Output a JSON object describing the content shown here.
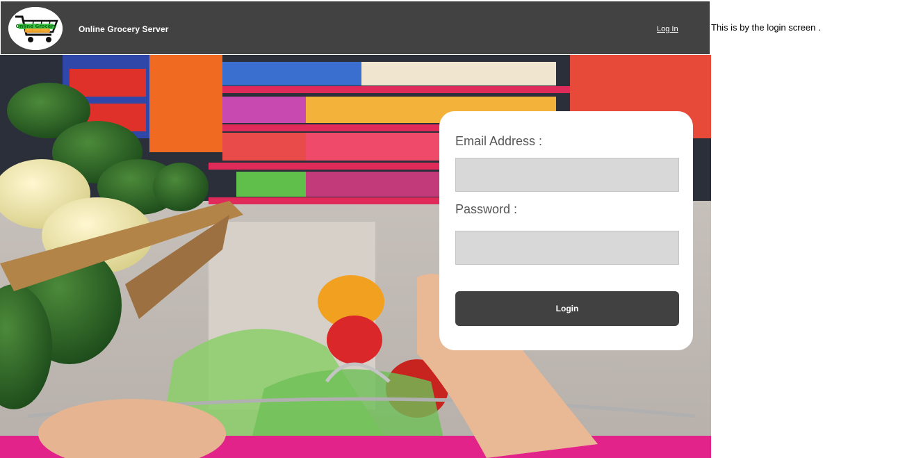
{
  "header": {
    "logo_icon": "shopping-cart-logo",
    "logo_text": "Online Grocery",
    "app_title": "Online Grocery Server",
    "login_link": "Log In"
  },
  "side_note": "This is by the login screen .",
  "hero": {
    "image": "supermarket-cart-photo"
  },
  "login_form": {
    "email_label": "Email Address :",
    "email_value": "",
    "password_label": "Password :",
    "password_value": "",
    "submit_label": "Login"
  },
  "colors": {
    "navbar": "#424242",
    "card": "#ffffff",
    "input": "#d8d8d8",
    "button": "#414141",
    "label": "#555555"
  }
}
